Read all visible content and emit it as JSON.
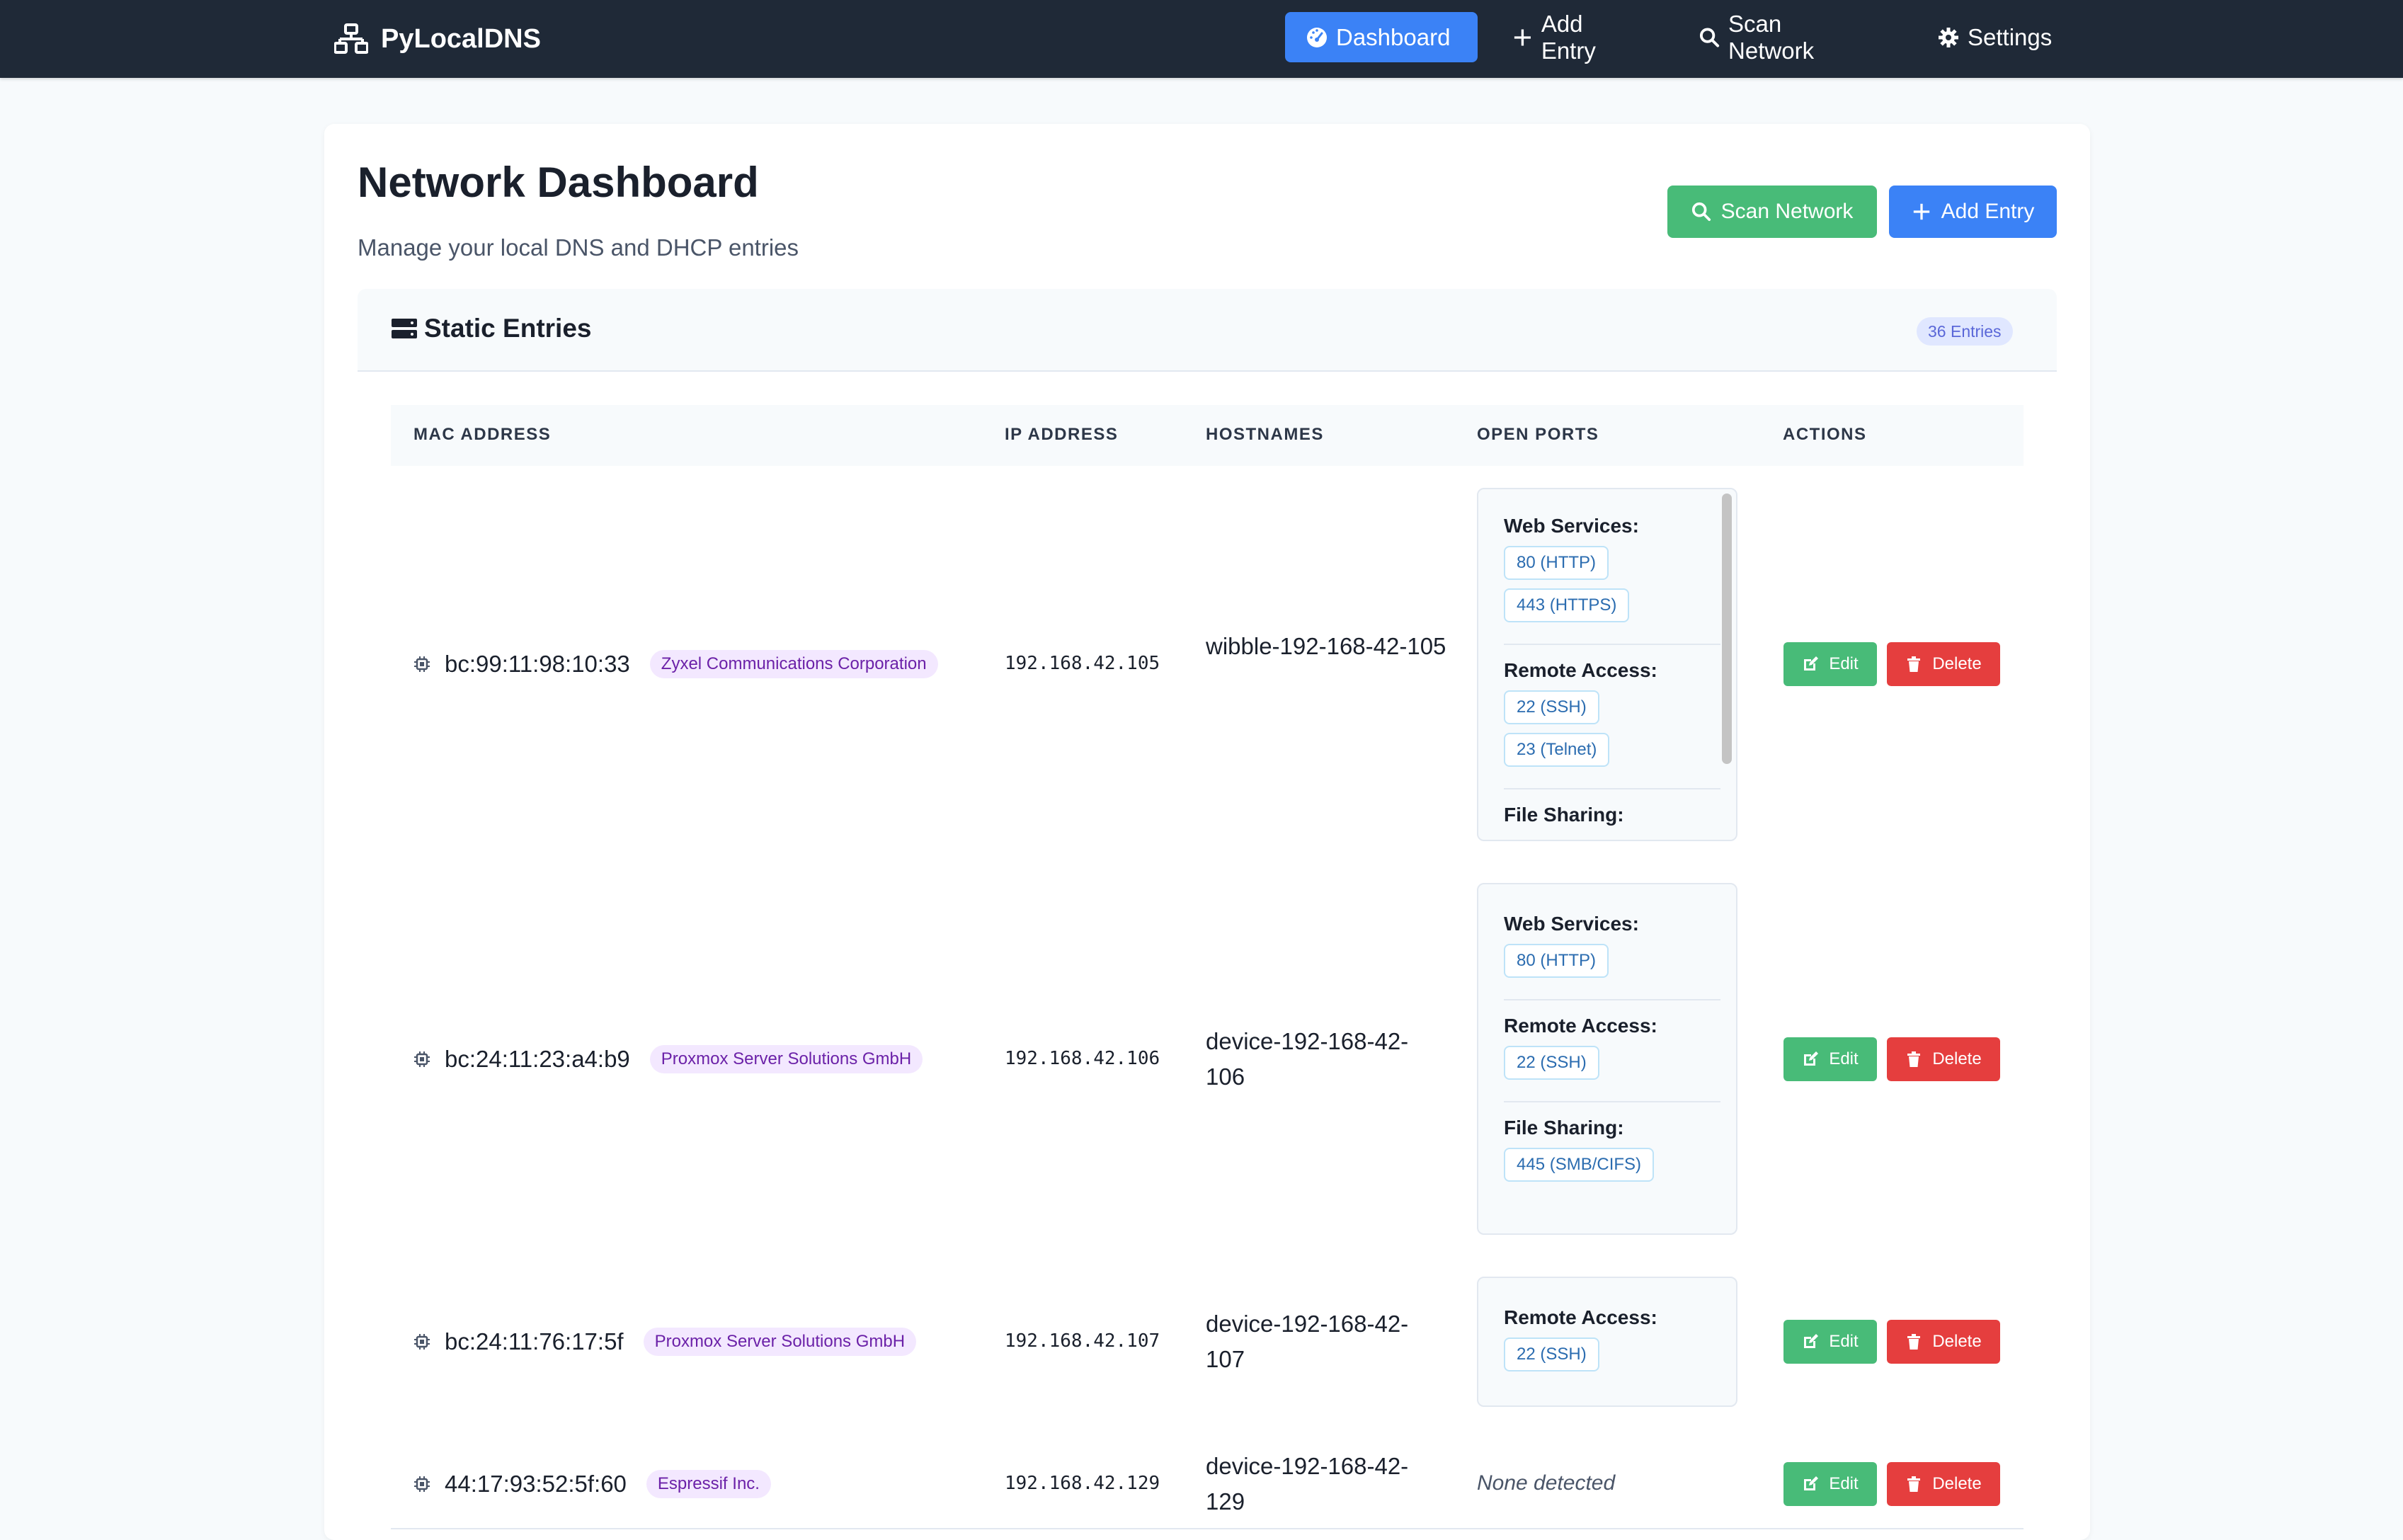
{
  "navbar": {
    "brand": "PyLocalDNS",
    "items": [
      {
        "label": "Dashboard",
        "icon": "tachometer-icon",
        "active": true
      },
      {
        "label": "Add Entry",
        "icon": "plus-icon"
      },
      {
        "label": "Scan Network",
        "icon": "search-icon"
      },
      {
        "label": "Settings",
        "icon": "gear-icon"
      }
    ]
  },
  "page": {
    "title": "Network Dashboard",
    "subtitle": "Manage your local DNS and DHCP entries",
    "scan_button": "Scan Network",
    "add_button": "Add Entry"
  },
  "section": {
    "title": "Static Entries",
    "count": "36 Entries"
  },
  "table": {
    "headers": [
      "MAC ADDRESS",
      "IP ADDRESS",
      "HOSTNAMES",
      "OPEN PORTS",
      "ACTIONS"
    ],
    "edit_label": "Edit",
    "delete_label": "Delete",
    "rows": [
      {
        "mac": "bc:99:11:98:10:33",
        "vendor": "Zyxel Communications Corporation",
        "ip": "192.168.42.105",
        "hostname": "wibble-192-168-42-105",
        "ports": [
          {
            "category": "Web Services:",
            "tags": [
              "80 (HTTP)",
              "443 (HTTPS)"
            ]
          },
          {
            "category": "Remote Access:",
            "tags": [
              "22 (SSH)",
              "23 (Telnet)"
            ]
          },
          {
            "category": "File Sharing:",
            "tags": []
          }
        ]
      },
      {
        "mac": "bc:24:11:23:a4:b9",
        "vendor": "Proxmox Server Solutions GmbH",
        "ip": "192.168.42.106",
        "hostname": "device-192-168-42-106",
        "ports": [
          {
            "category": "Web Services:",
            "tags": [
              "80 (HTTP)"
            ]
          },
          {
            "category": "Remote Access:",
            "tags": [
              "22 (SSH)"
            ]
          },
          {
            "category": "File Sharing:",
            "tags": [
              "445 (SMB/CIFS)"
            ]
          }
        ]
      },
      {
        "mac": "bc:24:11:76:17:5f",
        "vendor": "Proxmox Server Solutions GmbH",
        "ip": "192.168.42.107",
        "hostname": "device-192-168-42-107",
        "ports": [
          {
            "category": "Remote Access:",
            "tags": [
              "22 (SSH)"
            ]
          }
        ]
      },
      {
        "mac": "44:17:93:52:5f:60",
        "vendor": "Espressif Inc.",
        "ip": "192.168.42.129",
        "hostname": "device-192-168-42-129",
        "ports_none": "None detected"
      }
    ]
  }
}
